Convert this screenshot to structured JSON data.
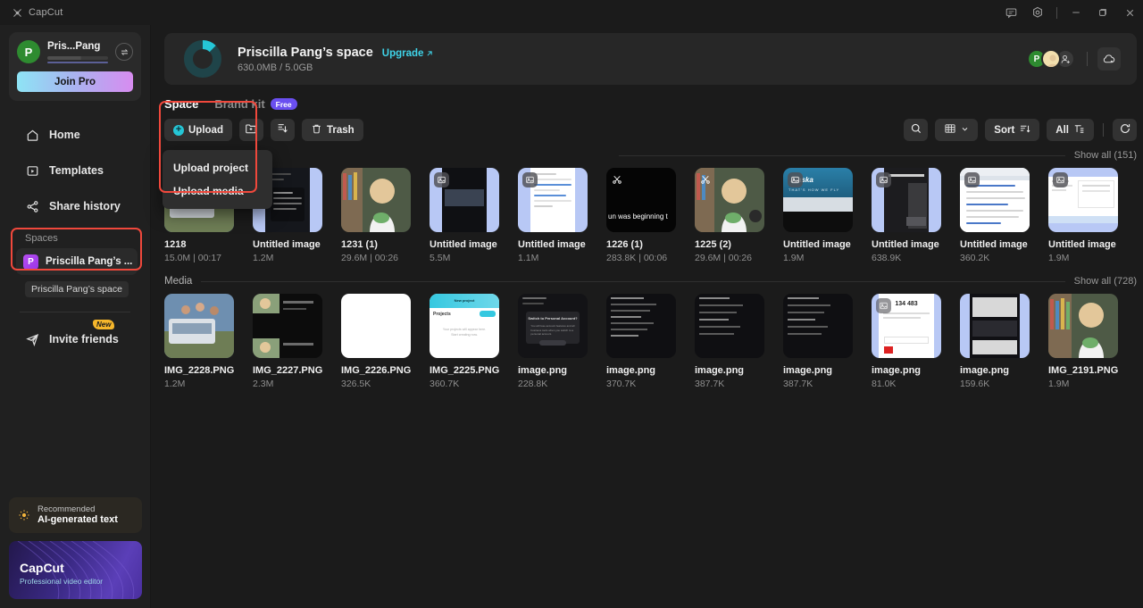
{
  "app": {
    "name": "CapCut"
  },
  "titlebar": {
    "feedback_icon": "feedback-icon",
    "settings_icon": "gear-icon",
    "minimize": "–",
    "maximize": "maximize-icon",
    "close": "✕"
  },
  "sidebar": {
    "user": {
      "initial": "P",
      "name": "Pris...Pang",
      "swap_icon": "switch-account-icon"
    },
    "join_pro_label": "Join Pro",
    "nav": [
      {
        "label": "Home",
        "icon": "home-icon"
      },
      {
        "label": "Templates",
        "icon": "templates-icon"
      },
      {
        "label": "Share history",
        "icon": "share-icon"
      }
    ],
    "spaces_label": "Spaces",
    "space_item": {
      "initial": "P",
      "label": "Priscilla Pang’s ..."
    },
    "tooltip": "Priscilla Pang’s space",
    "invite": {
      "label": "Invite friends",
      "badge": "New",
      "icon": "send-icon"
    },
    "recommended": {
      "kicker": "Recommended",
      "title": "AI-generated text",
      "icon": "sparkle-icon"
    },
    "promo": {
      "title": "CapCut",
      "subtitle": "Professional video editor"
    }
  },
  "space_header": {
    "title": "Priscilla Pang’s space",
    "upgrade_label": "Upgrade",
    "upgrade_icon": "arrow-up-right-icon",
    "storage": "630.0MB / 5.0GB",
    "members": [
      {
        "type": "initial",
        "initial": "P"
      },
      {
        "type": "photo"
      }
    ],
    "add_member_icon": "add-person-icon",
    "cloud_icon": "cloud-icon"
  },
  "tabs": [
    {
      "label": "Space",
      "active": true
    },
    {
      "label": "Brand kit",
      "active": false,
      "badge": "Free"
    }
  ],
  "toolbar": {
    "upload_label": "Upload",
    "upload_icon": "plus-circle-icon",
    "new_folder_icon": "new-folder-icon",
    "download_icon": "download-icon",
    "trash_label": "Trash",
    "trash_icon": "trash-icon",
    "search_icon": "search-icon",
    "grid_icon": "grid-view-icon",
    "chevron_icon": "chevron-down-icon",
    "sort_label": "Sort",
    "sort_icon": "sort-icon",
    "filter_label": "All",
    "filter_icon": "filter-icon",
    "refresh_icon": "refresh-icon"
  },
  "dropdown": {
    "items": [
      {
        "label": "Upload project"
      },
      {
        "label": "Upload media"
      }
    ]
  },
  "sections": [
    {
      "title": "",
      "show_all": "Show all (151)",
      "items": [
        {
          "name": "1218",
          "meta": "15.0M | 00:17",
          "kind": "photo-car"
        },
        {
          "name": "Untitled image",
          "meta": "1.2M",
          "kind": "dark-article"
        },
        {
          "name": "1231 (1)",
          "meta": "29.6M | 00:26",
          "kind": "photo-girl"
        },
        {
          "name": "Untitled image",
          "meta": "5.5M",
          "kind": "phone-dark"
        },
        {
          "name": "Untitled image",
          "meta": "1.1M",
          "kind": "phone-form"
        },
        {
          "name": "1226 (1)",
          "meta": "283.8K | 00:06",
          "kind": "black-text"
        },
        {
          "name": "1225 (2)",
          "meta": "29.6M | 00:26",
          "kind": "photo-girl2"
        },
        {
          "name": "Untitled image",
          "meta": "1.9M",
          "kind": "alaska"
        },
        {
          "name": "Untitled image",
          "meta": "638.9K",
          "kind": "phone-dark2"
        },
        {
          "name": "Untitled image",
          "meta": "360.2K",
          "kind": "browser-white"
        },
        {
          "name": "Untitled image",
          "meta": "1.9M",
          "kind": "doc-white"
        }
      ]
    },
    {
      "title": "Media",
      "show_all": "Show all (728)",
      "items": [
        {
          "name": "IMG_2228.PNG",
          "meta": "1.2M",
          "kind": "photo-car"
        },
        {
          "name": "IMG_2227.PNG",
          "meta": "2.3M",
          "kind": "dark-split"
        },
        {
          "name": "IMG_2226.PNG",
          "meta": "326.5K",
          "kind": "white-blank"
        },
        {
          "name": "IMG_2225.PNG",
          "meta": "360.7K",
          "kind": "projects-white"
        },
        {
          "name": "image.png",
          "meta": "228.8K",
          "kind": "dark-dialog"
        },
        {
          "name": "image.png",
          "meta": "370.7K",
          "kind": "dark-settings"
        },
        {
          "name": "image.png",
          "meta": "387.7K",
          "kind": "dark-settings2"
        },
        {
          "name": "image.png",
          "meta": "387.7K",
          "kind": "dark-settings3"
        },
        {
          "name": "image.png",
          "meta": "81.0K",
          "kind": "code-white"
        },
        {
          "name": "image.png",
          "meta": "159.6K",
          "kind": "phone-mixed"
        },
        {
          "name": "IMG_2191.PNG",
          "meta": "1.9M",
          "kind": "photo-girl3"
        }
      ]
    }
  ],
  "colors": {
    "accent": "#25c6d6",
    "highlight": "#f0483c",
    "purple": "#6a4ff0",
    "bg": "#1b1b1b",
    "sidebar_bg": "#202020"
  }
}
